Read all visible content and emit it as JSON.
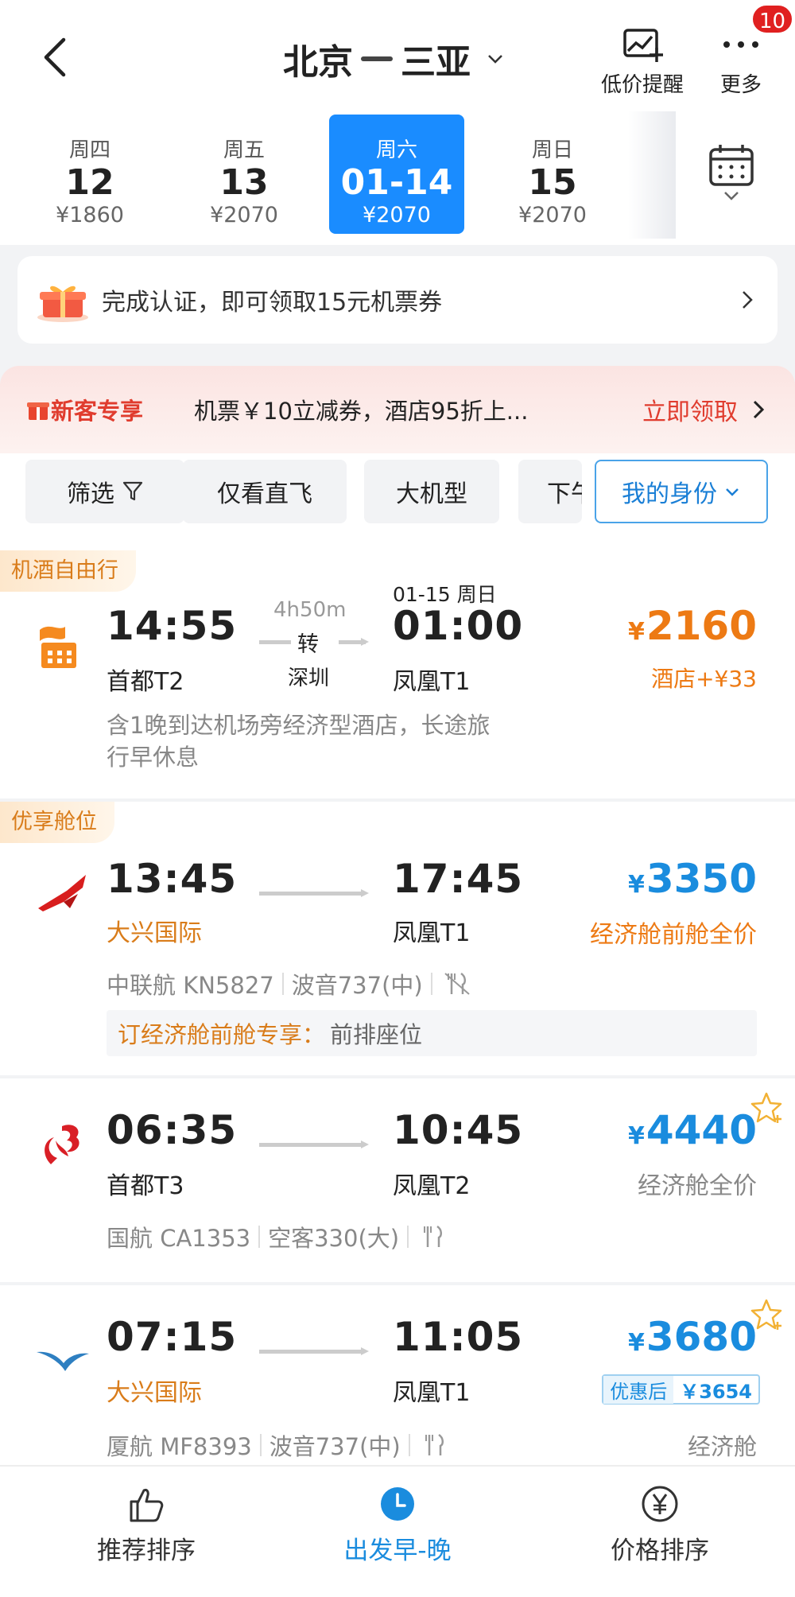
{
  "header": {
    "from": "北京",
    "to": "三亚",
    "alert_label": "低价提醒",
    "more_label": "更多",
    "badge_count": "10"
  },
  "dates": [
    {
      "weekday": "周四",
      "day": "12",
      "price": "¥1860"
    },
    {
      "weekday": "周五",
      "day": "13",
      "price": "¥2070"
    },
    {
      "weekday": "周六",
      "day": "01-14",
      "price": "¥2070",
      "active": true
    },
    {
      "weekday": "周日",
      "day": "15",
      "price": "¥2070"
    }
  ],
  "auth_banner": {
    "text": "完成认证，即可领取15元机票券"
  },
  "new_customer": {
    "tag": "新客专享",
    "message": "机票￥10立减券，酒店95折上...",
    "action": "立即领取"
  },
  "filters": {
    "filter": "筛选",
    "direct": "仅看直飞",
    "large_plane": "大机型",
    "partial": "下午",
    "identity": "我的身份"
  },
  "flights": [
    {
      "ribbon": "机酒自由行",
      "depart": "14:55",
      "depart_airport": "首都T2",
      "duration": "4h50m",
      "transfer": "转",
      "transfer_city": "深圳",
      "arrive_date": "01-15 周日",
      "arrive": "01:00",
      "arrive_airport": "凤凰T1",
      "price_symbol": "¥",
      "price": "2160",
      "sub": "酒店+¥33",
      "note": "含1晚到达机场旁经济型酒店，长途旅行早休息"
    },
    {
      "ribbon": "优享舱位",
      "depart": "13:45",
      "depart_airport": "大兴国际",
      "arrive": "17:45",
      "arrive_airport": "凤凰T1",
      "price_symbol": "¥",
      "price": "3350",
      "sub": "经济舱前舱全价",
      "airline": "中联航 KN5827",
      "plane": "波音737(中)",
      "perk_label": "订经济舱前舱专享：",
      "perk_value": "前排座位"
    },
    {
      "depart": "06:35",
      "depart_airport": "首都T3",
      "arrive": "10:45",
      "arrive_airport": "凤凰T2",
      "price_symbol": "¥",
      "price": "4440",
      "sub": "经济舱全价",
      "airline": "国航 CA1353",
      "plane": "空客330(大)"
    },
    {
      "depart": "07:15",
      "depart_airport": "大兴国际",
      "arrive": "11:05",
      "arrive_airport": "凤凰T1",
      "price_symbol": "¥",
      "price": "3680",
      "discount_label": "优惠后",
      "discount_price": "￥3654",
      "airline": "厦航 MF8393",
      "plane": "波音737(中)",
      "cabin": "经济舱"
    }
  ],
  "bottom_tabs": {
    "recommend": "推荐排序",
    "time": "出发早-晚",
    "price": "价格排序"
  },
  "colors": {
    "accent_blue": "#1a8cff",
    "price_blue": "#1a8cde",
    "price_orange": "#ed7a14",
    "promo_red": "#e03c2e"
  }
}
